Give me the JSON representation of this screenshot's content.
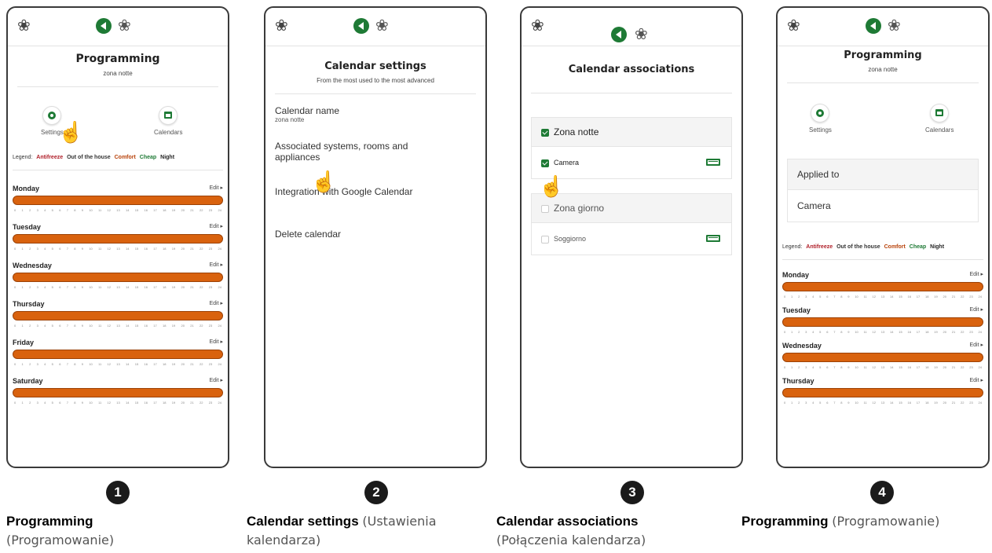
{
  "legend": {
    "prefix": "Legend:",
    "antifreeze": "Antifreeze",
    "out": "Out of the house",
    "comfort": "Comfort",
    "cheap": "Cheap",
    "night": "Night"
  },
  "hours": [
    "0",
    "1",
    "2",
    "3",
    "4",
    "5",
    "6",
    "7",
    "8",
    "9",
    "10",
    "11",
    "12",
    "13",
    "14",
    "15",
    "16",
    "17",
    "18",
    "19",
    "20",
    "21",
    "22",
    "23",
    "24"
  ],
  "screen1": {
    "title": "Programming",
    "subtitle": "zona notte",
    "settings": "Settings",
    "calendars": "Calendars",
    "edit": "Edit ▸",
    "days": [
      "Monday",
      "Tuesday",
      "Wednesday",
      "Thursday",
      "Friday",
      "Saturday"
    ]
  },
  "screen2": {
    "title": "Calendar settings",
    "subtitle": "From the most used to the most advanced",
    "name_label": "Calendar name",
    "name_value": "zona notte",
    "assoc_label": "Associated systems, rooms and appliances",
    "google_label": "Integration with Google Calendar",
    "delete_label": "Delete calendar"
  },
  "screen3": {
    "title": "Calendar associations",
    "group1": "Zona notte",
    "group1_room": "Camera",
    "group2": "Zona giorno",
    "group2_room": "Soggiorno"
  },
  "screen4": {
    "title": "Programming",
    "subtitle": "zona notte",
    "settings": "Settings",
    "calendars": "Calendars",
    "applied_to": "Applied to",
    "applied_value": "Camera",
    "edit": "Edit ▸",
    "days": [
      "Monday",
      "Tuesday",
      "Wednesday",
      "Thursday"
    ]
  },
  "steps": [
    "1",
    "2",
    "3",
    "4"
  ],
  "captions": [
    {
      "bold": "Programming",
      "light": "(Programowanie)"
    },
    {
      "bold": "Calendar settings",
      "light": "(Ustawienia kalendarza)"
    },
    {
      "bold": "Calendar associations",
      "light": "(Połączenia kalendarza)"
    },
    {
      "bold": "Programming",
      "light": "(Programowanie)"
    }
  ],
  "colors": {
    "accent": "#1e7a35",
    "bar": "#d9620e",
    "antifreeze": "#b0202a",
    "comfort": "#b8420a",
    "cheap": "#1e7a35",
    "night": "#222222"
  }
}
